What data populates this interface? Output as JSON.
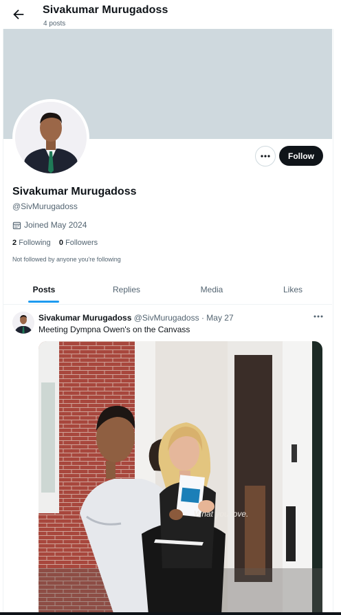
{
  "header": {
    "title": "Sivakumar Murugadoss",
    "subtitle": "4 posts"
  },
  "actions": {
    "follow_label": "Follow"
  },
  "profile": {
    "name": "Sivakumar Murugadoss",
    "handle": "@SivMurugadoss",
    "joined": "Joined May 2024",
    "following_count": "2",
    "following_label": "Following",
    "followers_count": "0",
    "followers_label": "Followers",
    "not_followed": "Not followed by anyone you're following"
  },
  "tabs": [
    {
      "label": "Posts",
      "active": true
    },
    {
      "label": "Replies",
      "active": false
    },
    {
      "label": "Media",
      "active": false
    },
    {
      "label": "Likes",
      "active": false
    }
  ],
  "post": {
    "author_name": "Sivakumar Murugadoss",
    "author_handle": "@SivMurugadoss",
    "date": "· May 27",
    "text": "Meeting Dympna Owen's on the Canvass",
    "leaflet_text": "What you love."
  },
  "colors": {
    "accent": "#1d9bf0",
    "banner": "#cfd9de",
    "primary_button": "#0f1419",
    "secondary_text": "#536471"
  },
  "icons": [
    "back-arrow-icon",
    "more-horizontal-icon",
    "calendar-icon"
  ]
}
